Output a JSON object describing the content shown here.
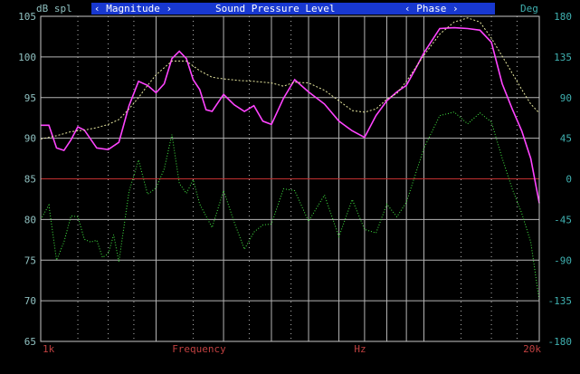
{
  "header": {
    "left_unit": "dB spl",
    "tab_magnitude": "‹ Magnitude ›",
    "title": "Sound Pressure Level",
    "tab_phase": "‹ Phase ›",
    "right_unit": "Deg"
  },
  "colors": {
    "background": "#000000",
    "frame": "#c8c8c8",
    "grid": "#b4b4b4",
    "left_axis_text": "#8fc0c0",
    "right_axis_text": "#3fb0b0",
    "bottom_text": "#c04040",
    "tab_bg": "#1838d0",
    "tab_text": "#ffffff",
    "magnitude": "#ff44ff",
    "magnitude_ref": "#e8e8a0",
    "phase": "#44ee44",
    "zero_line": "#c03030"
  },
  "chart_data": {
    "type": "line",
    "xscale": "log",
    "xlim": [
      1000,
      20000
    ],
    "ylim_left": [
      65,
      105
    ],
    "ylim_right": [
      -180,
      180
    ],
    "x_tick_labels": [
      "1k",
      "Frequency",
      "Hz",
      "20k"
    ],
    "y_left_ticks": [
      "105",
      "100",
      "95",
      "90",
      "85",
      "80",
      "75",
      "70",
      "65"
    ],
    "y_right_ticks": [
      "180",
      "135",
      "90",
      "45",
      "0",
      "-45",
      "-90",
      "-135",
      "-180"
    ],
    "series": [
      {
        "name": "Magnitude",
        "axis": "left",
        "x": [
          1000,
          1050,
          1100,
          1150,
          1200,
          1250,
          1300,
          1400,
          1500,
          1600,
          1700,
          1800,
          1900,
          2000,
          2100,
          2200,
          2300,
          2400,
          2500,
          2600,
          2700,
          2800,
          3000,
          3200,
          3400,
          3600,
          3800,
          4000,
          4300,
          4600,
          5000,
          5500,
          6000,
          6500,
          7000,
          7500,
          8000,
          8500,
          9000,
          9500,
          10000,
          11000,
          12000,
          13000,
          14000,
          15000,
          16000,
          17000,
          18000,
          19000,
          20000
        ],
        "y": [
          91.6,
          91.6,
          88.8,
          88.5,
          89.8,
          91.4,
          91.0,
          88.8,
          88.6,
          89.5,
          94.0,
          97.0,
          96.5,
          95.6,
          96.7,
          99.8,
          100.7,
          99.8,
          97.2,
          96.0,
          93.5,
          93.3,
          95.4,
          94.1,
          93.3,
          94.0,
          92.1,
          91.7,
          94.9,
          97.2,
          95.7,
          94.2,
          92.1,
          90.9,
          90.1,
          92.8,
          94.6,
          95.7,
          96.5,
          98.5,
          100.5,
          103.5,
          103.6,
          103.5,
          103.3,
          101.8,
          96.7,
          93.6,
          90.9,
          87.5,
          82.0
        ]
      },
      {
        "name": "Magnitude (smoothed)",
        "axis": "left",
        "x": [
          1000,
          1100,
          1200,
          1300,
          1400,
          1500,
          1600,
          1700,
          1800,
          1900,
          2000,
          2200,
          2400,
          2600,
          2800,
          3000,
          3300,
          3600,
          4000,
          4300,
          4600,
          5000,
          5500,
          6000,
          6500,
          7000,
          7500,
          8000,
          8500,
          9000,
          10000,
          11000,
          12000,
          13000,
          14000,
          15000,
          16000,
          17000,
          18000,
          19000,
          20000
        ],
        "y": [
          89.9,
          90.3,
          90.8,
          91.0,
          91.3,
          91.7,
          92.3,
          93.6,
          95.0,
          96.5,
          97.8,
          99.5,
          99.5,
          98.3,
          97.5,
          97.3,
          97.1,
          97.0,
          96.8,
          96.4,
          96.9,
          96.8,
          95.9,
          94.6,
          93.4,
          93.2,
          93.6,
          94.8,
          95.5,
          97.0,
          100.2,
          102.8,
          104.3,
          104.8,
          104.3,
          102.3,
          100.1,
          98.0,
          96.0,
          94.2,
          93.1
        ]
      },
      {
        "name": "Phase",
        "axis": "right",
        "x": [
          1000,
          1050,
          1100,
          1150,
          1200,
          1250,
          1300,
          1350,
          1400,
          1450,
          1500,
          1550,
          1600,
          1700,
          1800,
          1900,
          2000,
          2100,
          2200,
          2300,
          2400,
          2500,
          2600,
          2800,
          3000,
          3200,
          3400,
          3600,
          3800,
          4000,
          4300,
          4600,
          5000,
          5500,
          6000,
          6500,
          7000,
          7500,
          8000,
          8500,
          9000,
          10000,
          11000,
          12000,
          13000,
          14000,
          15000,
          16000,
          17000,
          18000,
          19000,
          20000
        ],
        "y": [
          -45,
          -29,
          -90,
          -70,
          -41,
          -42,
          -67,
          -70,
          -68,
          -87,
          -83,
          -62,
          -92,
          -14,
          21,
          -17,
          -10,
          11,
          49,
          -5,
          -16,
          -1,
          -28,
          -54,
          -13,
          -48,
          -78,
          -59,
          -51,
          -50,
          -11,
          -13,
          -47,
          -18,
          -64,
          -23,
          -56,
          -60,
          -28,
          -42,
          -26,
          34,
          70,
          74,
          61,
          73,
          63,
          23,
          -11,
          -38,
          -70,
          -135
        ]
      }
    ],
    "reference_line": {
      "axis": "right",
      "value": 0
    }
  }
}
